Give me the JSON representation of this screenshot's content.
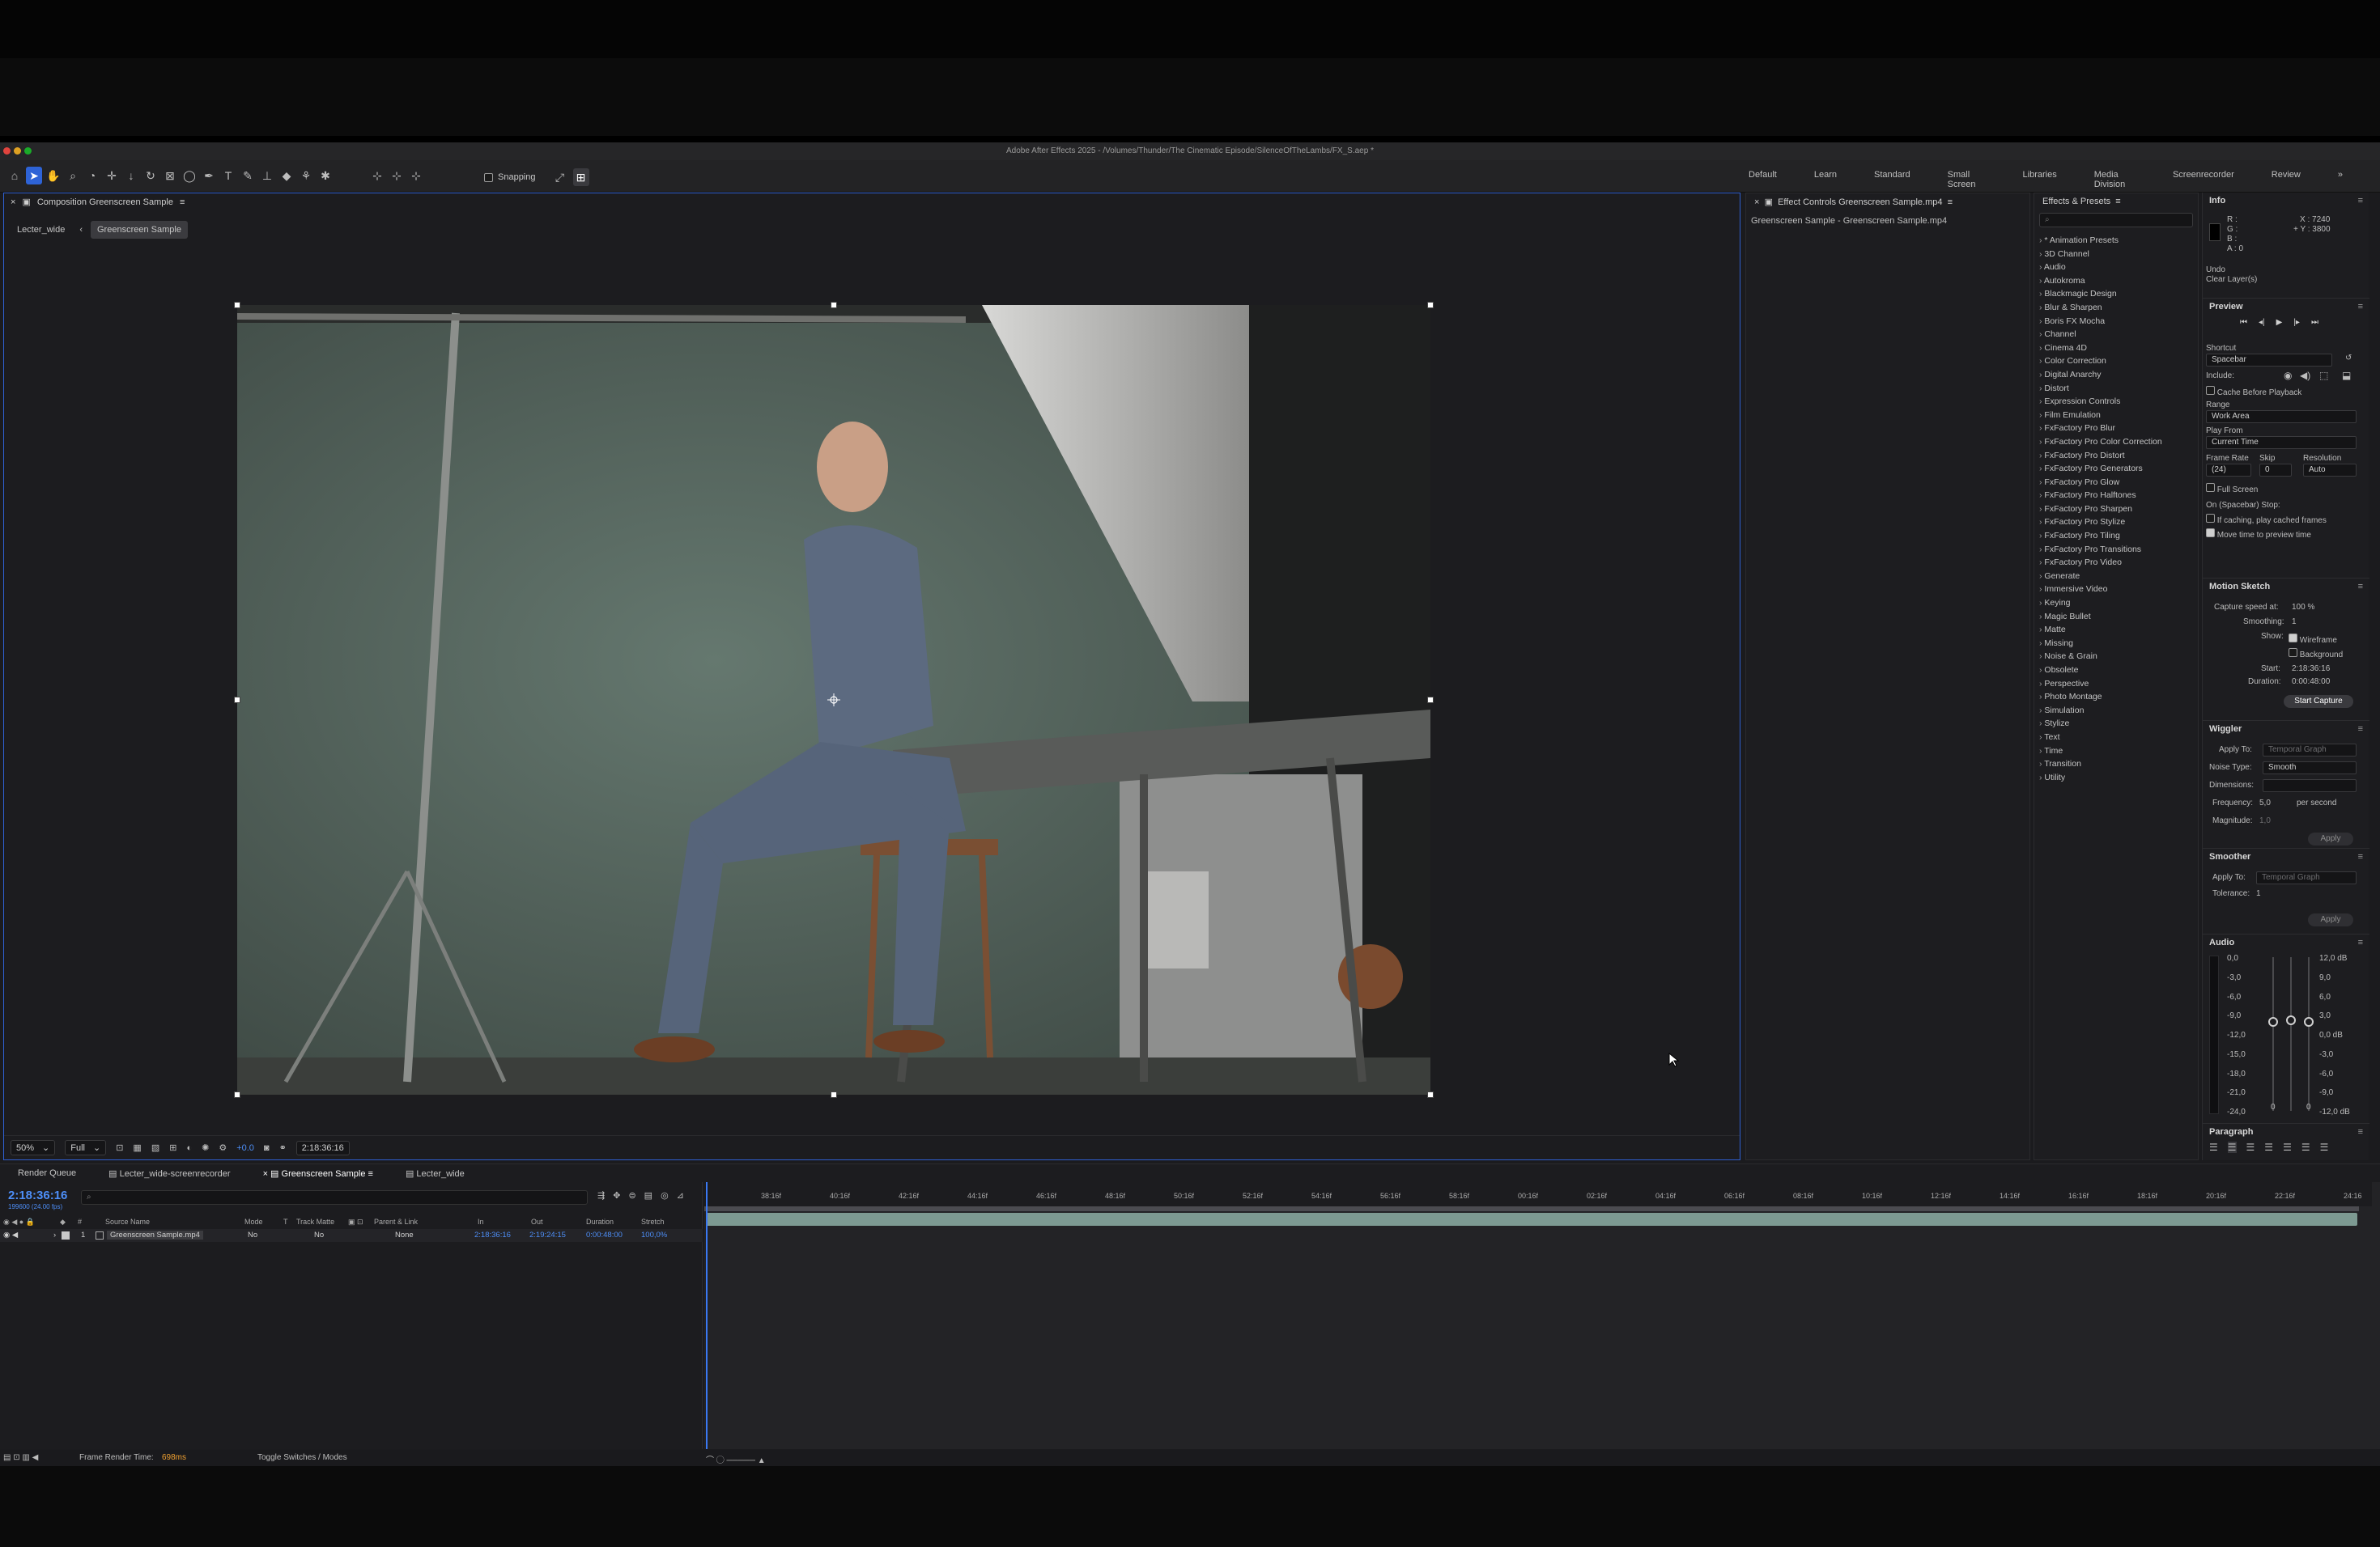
{
  "window": {
    "title": "Adobe After Effects 2025 - /Volumes/Thunder/The Cinematic Episode/SilenceOfTheLambs/FX_S.aep *"
  },
  "toolbar": {
    "snapping_label": "Snapping",
    "workspaces": [
      "Default",
      "Learn",
      "Standard",
      "Small Screen",
      "Libraries",
      "Media Division",
      "Screenrecorder",
      "Review"
    ],
    "overflow": "»"
  },
  "composition": {
    "panel_title": "Composition Greenscreen Sample",
    "breadcrumbs": [
      "Lecter_wide",
      "Greenscreen Sample"
    ],
    "zoom": "50%",
    "resolution": "Full",
    "exposure": "+0.0",
    "timecode": "2:18:36:16"
  },
  "effect_controls": {
    "title": "Effect Controls Greenscreen Sample.mp4",
    "layer": "Greenscreen Sample - Greenscreen Sample.mp4"
  },
  "effects_presets": {
    "title": "Effects & Presets",
    "search_placeholder": "",
    "items": [
      "* Animation Presets",
      "3D Channel",
      "Audio",
      "Autokroma",
      "Blackmagic Design",
      "Blur & Sharpen",
      "Boris FX Mocha",
      "Channel",
      "Cinema 4D",
      "Color Correction",
      "Digital Anarchy",
      "Distort",
      "Expression Controls",
      "Film Emulation",
      "FxFactory Pro Blur",
      "FxFactory Pro Color Correction",
      "FxFactory Pro Distort",
      "FxFactory Pro Generators",
      "FxFactory Pro Glow",
      "FxFactory Pro Halftones",
      "FxFactory Pro Sharpen",
      "FxFactory Pro Stylize",
      "FxFactory Pro Tiling",
      "FxFactory Pro Transitions",
      "FxFactory Pro Video",
      "Generate",
      "Immersive Video",
      "Keying",
      "Magic Bullet",
      "Matte",
      "Missing",
      "Noise & Grain",
      "Obsolete",
      "Perspective",
      "Photo Montage",
      "Simulation",
      "Stylize",
      "Text",
      "Time",
      "Transition",
      "Utility"
    ]
  },
  "info": {
    "title": "Info",
    "r": "R :",
    "g": "G :",
    "b": "B :",
    "a": "A : 0",
    "x": "X : 7240",
    "y": "+ Y : 3800",
    "undo": "Undo",
    "undo_action": "Clear Layer(s)"
  },
  "preview": {
    "title": "Preview",
    "shortcut_label": "Shortcut",
    "shortcut_value": "Spacebar",
    "include_label": "Include:",
    "cache_label": "Cache Before Playback",
    "range_label": "Range",
    "range_value": "Work Area",
    "play_from_label": "Play From",
    "play_from_value": "Current Time",
    "frame_rate_label": "Frame Rate",
    "skip_label": "Skip",
    "resolution_label": "Resolution",
    "frame_rate_value": "(24)",
    "skip_value": "0",
    "resolution_value": "Auto",
    "full_screen_label": "Full Screen",
    "on_stop_label": "On (Spacebar) Stop:",
    "if_caching_label": "If caching, play cached frames",
    "move_time_label": "Move time to preview time"
  },
  "motion_sketch": {
    "title": "Motion Sketch",
    "capture_speed_label": "Capture speed at:",
    "capture_speed_value": "100 %",
    "smoothing_label": "Smoothing:",
    "smoothing_value": "1",
    "show_label": "Show:",
    "wireframe_label": "Wireframe",
    "background_label": "Background",
    "start_label": "Start:",
    "start_value": "2:18:36:16",
    "duration_label": "Duration:",
    "duration_value": "0:00:48:00",
    "start_capture": "Start Capture"
  },
  "wiggler": {
    "title": "Wiggler",
    "apply_to_label": "Apply To:",
    "apply_to_value": "Temporal Graph",
    "noise_type_label": "Noise Type:",
    "noise_type_value": "Smooth",
    "dimensions_label": "Dimensions:",
    "frequency_label": "Frequency:",
    "frequency_value": "5,0",
    "frequency_unit": "per second",
    "magnitude_label": "Magnitude:",
    "magnitude_value": "1,0",
    "apply": "Apply"
  },
  "smoother": {
    "title": "Smoother",
    "apply_to_label": "Apply To:",
    "apply_to_value": "Temporal Graph",
    "tolerance_label": "Tolerance:",
    "tolerance_value": "1",
    "apply": "Apply"
  },
  "audio": {
    "title": "Audio",
    "left_scale": [
      "0,0",
      "-3,0",
      "-6,0",
      "-9,0",
      "-12,0",
      "-15,0",
      "-18,0",
      "-21,0",
      "-24,0"
    ],
    "right_scale": [
      "12,0 dB",
      "9,0",
      "6,0",
      "3,0",
      "0,0 dB",
      "-3,0",
      "-6,0",
      "-9,0",
      "-12,0 dB"
    ],
    "left_value": "0",
    "right_value": "0"
  },
  "paragraph": {
    "title": "Paragraph"
  },
  "timeline": {
    "tabs": [
      "Render Queue",
      "Lecter_wide-screenrecorder",
      "Greenscreen Sample",
      "Lecter_wide"
    ],
    "timecode": "2:18:36:16",
    "timecode_sub": "199600 (24.00 fps)",
    "columns": [
      "Source Name",
      "Mode",
      "T",
      "Track Matte",
      "Parent & Link",
      "In",
      "Out",
      "Duration",
      "Stretch"
    ],
    "layer": {
      "index": "1",
      "name": "Greenscreen Sample.mp4",
      "mode": "No",
      "matte": "No",
      "parent": "None",
      "in": "2:18:36:16",
      "out": "2:19:24:15",
      "duration": "0:00:48:00",
      "stretch": "100,0%"
    },
    "ruler_ticks": [
      "38:16f",
      "40:16f",
      "42:16f",
      "44:16f",
      "46:16f",
      "48:16f",
      "50:16f",
      "52:16f",
      "54:16f",
      "56:16f",
      "58:16f",
      "00:16f",
      "02:16f",
      "04:16f",
      "06:16f",
      "08:16f",
      "10:16f",
      "12:16f",
      "14:16f",
      "16:16f",
      "18:16f",
      "20:16f",
      "22:16f",
      "24:16"
    ]
  },
  "status": {
    "frame_render_label": "Frame Render Time:",
    "frame_render_value": "698ms",
    "toggle_label": "Toggle Switches / Modes"
  }
}
